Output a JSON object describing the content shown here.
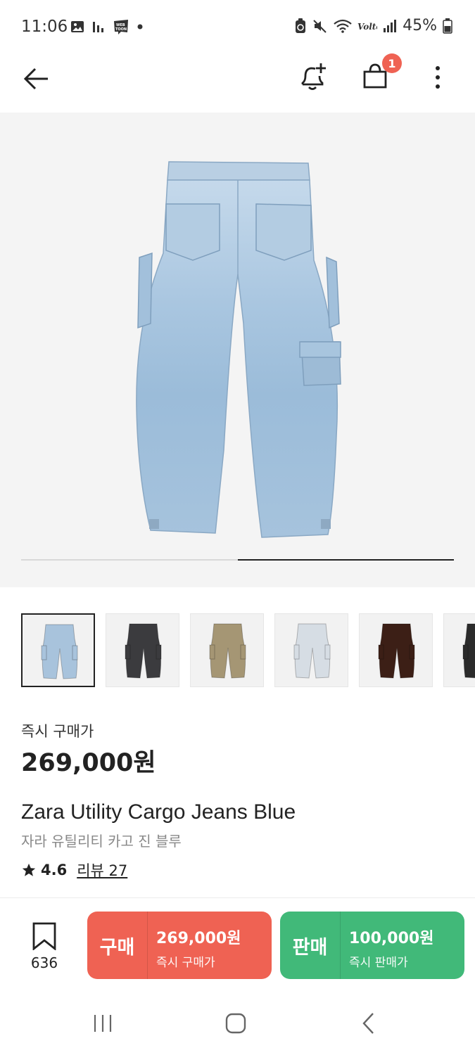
{
  "status_bar": {
    "time": "11:06",
    "battery": "45%",
    "left_icons": [
      "gallery-icon",
      "stats-icon",
      "webtoon-icon",
      "dot-icon"
    ],
    "right_icons": [
      "recycle-icon",
      "mute-icon",
      "wifi-icon",
      "volte-icon",
      "signal-icon",
      "battery-icon"
    ]
  },
  "header": {
    "back_icon": "arrow-left-icon",
    "bell_icon": "bell-plus-icon",
    "cart_icon": "shopping-bag-icon",
    "cart_badge": "1",
    "menu_icon": "more-vertical-icon"
  },
  "gallery": {
    "progress_fraction_start": 0.5,
    "progress_fraction_end": 1.0,
    "thumbnails": [
      {
        "name": "light-blue-cargo-jeans",
        "color": "#a8c3dc",
        "active": true
      },
      {
        "name": "black-cargo-jeans",
        "color": "#3b3b3e",
        "active": false
      },
      {
        "name": "khaki-cargo-pants",
        "color": "#a59674",
        "active": false
      },
      {
        "name": "pale-blue-cargo-jeans",
        "color": "#d6dde4",
        "active": false
      },
      {
        "name": "brown-cargo-pants",
        "color": "#3c1f16",
        "active": false
      },
      {
        "name": "dark-cargo-jeans",
        "color": "#2b2b2b",
        "active": false
      }
    ]
  },
  "product": {
    "price_label": "즉시 구매가",
    "price": "269,000원",
    "name": "Zara Utility Cargo Jeans Blue",
    "name_ko": "자라 유틸리티 카고 진 블루",
    "rating": "4.6",
    "review": "리뷰 27"
  },
  "actions": {
    "bookmark_count": "636",
    "buy": {
      "label": "구매",
      "price": "269,000원",
      "sub": "즉시 구매가"
    },
    "sell": {
      "label": "판매",
      "price": "100,000원",
      "sub": "즉시 판매가"
    }
  },
  "colors": {
    "buy": "#ef6253",
    "sell": "#41b979",
    "badge": "#ef6253"
  }
}
